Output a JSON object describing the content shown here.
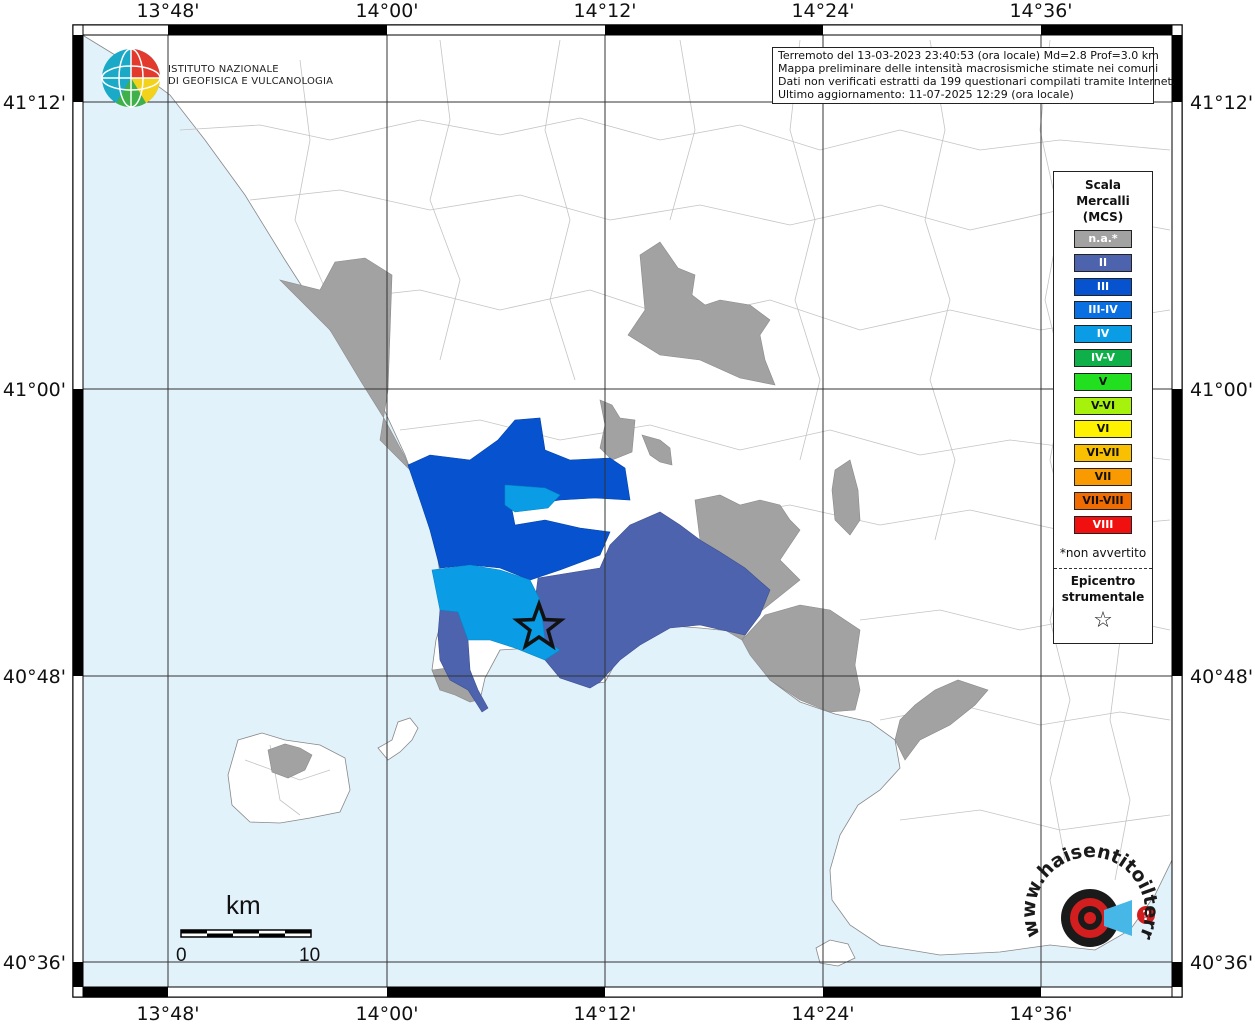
{
  "map": {
    "top_ticks": [
      "13°48'",
      "14°00'",
      "14°12'",
      "14°24'",
      "14°36'"
    ],
    "bottom_ticks": [
      "13°48'",
      "14°00'",
      "14°12'",
      "14°24'",
      "14°36'"
    ],
    "left_ticks": [
      "41°12'",
      "41°00'",
      "40°48'",
      "40°36'"
    ],
    "right_ticks": [
      "41°12'",
      "41°00'",
      "40°48'",
      "40°36'"
    ],
    "colors": {
      "sea": "#e2f2fb",
      "land": "#ffffff",
      "not_felt": "#a2a2a2",
      "intensity_II": "#4e63ad",
      "intensity_III": "#0652cf",
      "intensity_IV": "#0a9de6"
    }
  },
  "info": {
    "line1": "Terremoto del 13-03-2023 23:40:53 (ora locale) Md=2.8 Prof=3.0 km",
    "line2": "Mappa preliminare delle intensità macrosismiche stimate nei comuni",
    "line3": "Dati non verificati estratti da 199 questionari compilati tramite Internet.",
    "line4": "Ultimo aggiornamento: 11-07-2025 12:29 (ora locale)"
  },
  "logo": {
    "line1": "ISTITUTO NAZIONALE",
    "line2": "DI GEOFISICA E VULCANOLOGIA"
  },
  "legend": {
    "title1": "Scala",
    "title2": "Mercalli",
    "title3": "(MCS)",
    "items": [
      {
        "label": "n.a.*",
        "color": "#a2a2a2",
        "text": "#ffffff"
      },
      {
        "label": "II",
        "color": "#4e63ad",
        "text": "#ffffff"
      },
      {
        "label": "III",
        "color": "#0652cf",
        "text": "#ffffff"
      },
      {
        "label": "III-IV",
        "color": "#0a6fe0",
        "text": "#ffffff"
      },
      {
        "label": "IV",
        "color": "#0a9de6",
        "text": "#ffffff"
      },
      {
        "label": "IV-V",
        "color": "#0fb04a",
        "text": "#ffffff"
      },
      {
        "label": "V",
        "color": "#22e020",
        "text": "#111111"
      },
      {
        "label": "V-VI",
        "color": "#a6f20c",
        "text": "#111111"
      },
      {
        "label": "VI",
        "color": "#fff200",
        "text": "#111111"
      },
      {
        "label": "VI-VII",
        "color": "#f8c000",
        "text": "#111111"
      },
      {
        "label": "VII",
        "color": "#f89a00",
        "text": "#111111"
      },
      {
        "label": "VII-VIII",
        "color": "#f06c00",
        "text": "#111111"
      },
      {
        "label": "VIII",
        "color": "#f01010",
        "text": "#ffffff"
      }
    ],
    "note": "*non avvertito",
    "epicenter1": "Epicentro",
    "epicenter2": "strumentale",
    "star": "☆"
  },
  "scalebar": {
    "unit": "km",
    "min": "0",
    "max": "10"
  },
  "badge": {
    "text": "www.haisentitoilterremoto.it",
    "question": "?"
  }
}
